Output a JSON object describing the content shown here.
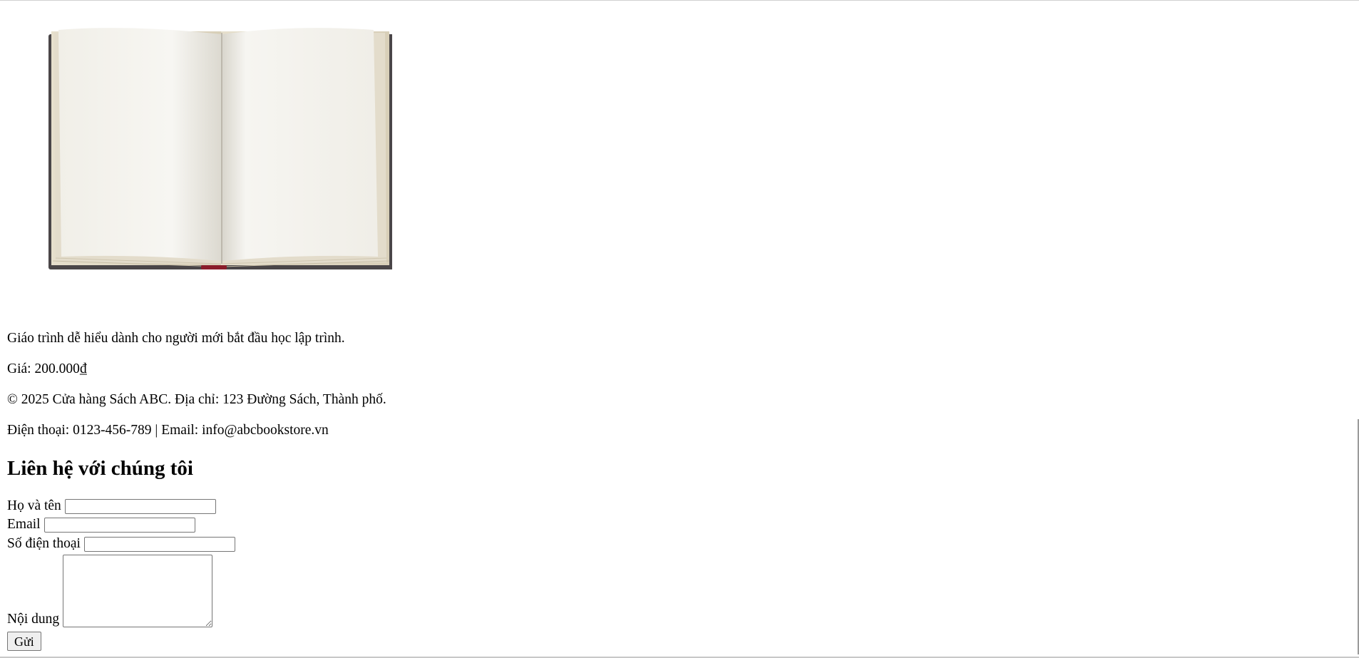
{
  "product": {
    "image_icon": "open-book-image",
    "description": "Giáo trình dễ hiểu dành cho người mới bắt đầu học lập trình.",
    "price": "Giá: 200.000₫"
  },
  "footer": {
    "copyright": "© 2025 Cửa hàng Sách ABC. Địa chỉ: 123 Đường Sách, Thành phố.",
    "contact": "Điện thoại: 0123-456-789 | Email: info@abcbookstore.vn"
  },
  "contact_form": {
    "heading": "Liên hệ với chúng tôi",
    "name_label": "Họ và tên",
    "name_value": "",
    "email_label": "Email",
    "email_value": "",
    "phone_label": "Số điện thoại",
    "phone_value": "",
    "message_label": "Nội dung",
    "message_value": "",
    "submit_label": "Gửi"
  }
}
